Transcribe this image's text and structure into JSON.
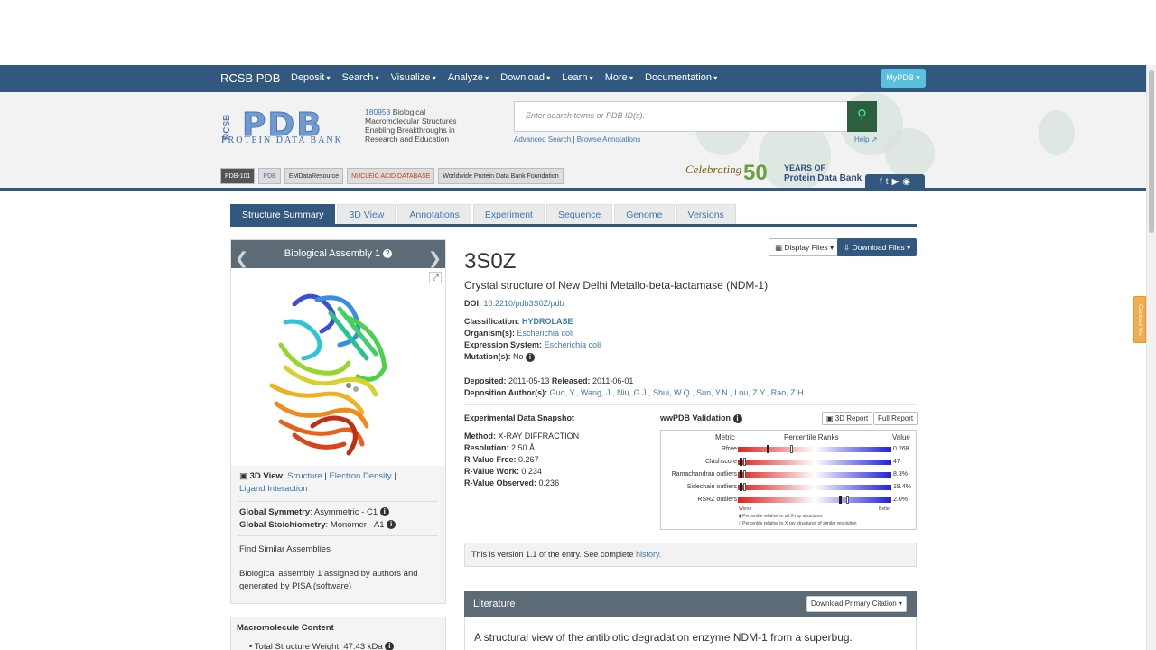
{
  "nav": {
    "brand": "RCSB PDB",
    "items": [
      "Deposit",
      "Search",
      "Visualize",
      "Analyze",
      "Download",
      "Learn",
      "More",
      "Documentation"
    ],
    "mypdb": "MyPDB"
  },
  "header": {
    "logo_rcsb": "RCSB",
    "logo_pdb": "PDB",
    "logo_sub": "PROTEIN DATA BANK",
    "count": "180953",
    "tagline": "Biological Macromolecular Structures Enabling Breakthroughs in Research and Education",
    "search_placeholder": "Enter search terms or PDB ID(s).",
    "advanced_search": "Advanced Search",
    "separator": "|",
    "browse_annotations": "Browse Annotations",
    "help": "Help",
    "partners": [
      "PDB-101",
      "PDB",
      "EMDataResource",
      "NUCLEIC ACID DATABASE",
      "Worldwide Protein Data Bank Foundation"
    ],
    "celebrating": "Celebrating",
    "years_number": "50",
    "years_line1": "YEARS OF",
    "years_line2": "Protein Data Bank"
  },
  "tabs": [
    "Structure Summary",
    "3D View",
    "Annotations",
    "Experiment",
    "Sequence",
    "Genome",
    "Versions"
  ],
  "assembly": {
    "title": "Biological Assembly 1",
    "view_label": "3D View",
    "view_links": [
      "Structure",
      "Electron Density",
      "Ligand Interaction"
    ],
    "symmetry_label": "Global Symmetry",
    "symmetry_value": "Asymmetric - C1",
    "stoich_label": "Global Stoichiometry",
    "stoich_value": "Monomer - A1",
    "find_similar": "Find Similar Assemblies",
    "note": "Biological assembly 1 assigned by authors and generated by PISA (software)"
  },
  "macromolecule": {
    "title": "Macromolecule Content",
    "weight_label": "Total Structure Weight",
    "weight_value": "47.43 kDa"
  },
  "entry": {
    "display_files": "Display Files",
    "download_files": "Download Files",
    "id": "3S0Z",
    "title": "Crystal structure of New Delhi Metallo-beta-lactamase (NDM-1)",
    "doi_label": "DOI:",
    "doi": "10.2210/pdb3S0Z/pdb",
    "classification_label": "Classification:",
    "classification": "HYDROLASE",
    "organism_label": "Organism(s):",
    "organism": "Escherichia coli",
    "expression_label": "Expression System:",
    "expression": "Escherichia coli",
    "mutation_label": "Mutation(s):",
    "mutation": "No",
    "deposited_label": "Deposited:",
    "deposited": "2011-05-13",
    "released_label": "Released:",
    "released": "2011-06-01",
    "authors_label": "Deposition Author(s):",
    "authors": "Guo, Y., Wang, J., Niu, G.J., Shui, W.Q., Sun, Y.N., Lou, Z.Y., Rao, Z.H."
  },
  "snapshot": {
    "title": "Experimental Data Snapshot",
    "rows": [
      {
        "label": "Method:",
        "value": "X-RAY DIFFRACTION"
      },
      {
        "label": "Resolution:",
        "value": "2.50 Å"
      },
      {
        "label": "R-Value Free:",
        "value": "0.267"
      },
      {
        "label": "R-Value Work:",
        "value": "0.234"
      },
      {
        "label": "R-Value Observed:",
        "value": "0.236"
      }
    ]
  },
  "validation": {
    "title": "wwPDB Validation",
    "report_3d": "3D Report",
    "full_report": "Full Report",
    "col_metric": "Metric",
    "col_percentile": "Percentile Ranks",
    "col_value": "Value",
    "rows": [
      {
        "metric": "Rfree",
        "value": "0.268",
        "all_pct": 0.19,
        "sim_pct": 0.32
      },
      {
        "metric": "Clashscore",
        "value": "47",
        "all_pct": 0.01,
        "sim_pct": 0.01
      },
      {
        "metric": "Ramachandran outliers",
        "value": "8.3%",
        "all_pct": 0.01,
        "sim_pct": 0.01
      },
      {
        "metric": "Sidechain outliers",
        "value": "18.4%",
        "all_pct": 0.01,
        "sim_pct": 0.01
      },
      {
        "metric": "RSRZ outliers",
        "value": "2.0%",
        "all_pct": 0.66,
        "sim_pct": 0.68
      }
    ],
    "worse": "Worse",
    "better": "Better",
    "legend_all": "Percentile relative to all X-ray structures",
    "legend_sim": "Percentile relative to X-ray structures of similar resolution"
  },
  "version": {
    "text": "This is version 1.1 of the entry. See complete",
    "link": "history."
  },
  "literature": {
    "title": "Literature",
    "download_citation": "Download Primary Citation",
    "paper_title": "A structural view of the antibiotic degradation enzyme NDM-1 from a superbug."
  },
  "contact": "Contact Us",
  "colors": {
    "nav": "#325880",
    "panel_header": "#5d6b76",
    "link": "#3c78b4",
    "search_button": "#2b5f3f",
    "mypdb": "#5bc0de"
  }
}
